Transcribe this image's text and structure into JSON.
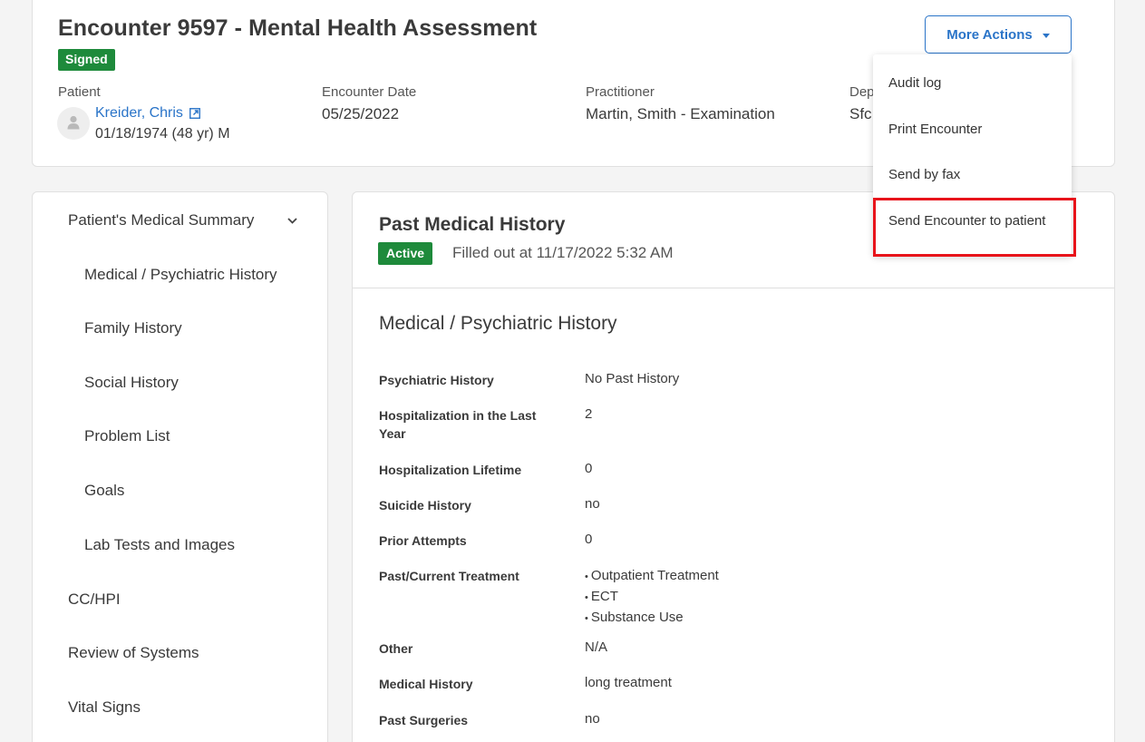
{
  "encounter": {
    "title": "Encounter 9597 - Mental Health Assessment",
    "status": "Signed",
    "patient_label": "Patient",
    "patient_name": "Kreider, Chris",
    "patient_dob": "01/18/1974 (48 yr) M",
    "date_label": "Encounter Date",
    "date_value": "05/25/2022",
    "practitioner_label": "Practitioner",
    "practitioner_value": "Martin, Smith - Examination",
    "department_label": "Dep",
    "department_value": "Sfc"
  },
  "more_actions": {
    "label": "More Actions",
    "items": [
      "Audit log",
      "Print Encounter",
      "Send by fax",
      "Send Encounter to patient"
    ]
  },
  "sidebar": {
    "items": [
      {
        "label": "Patient's Medical Summary",
        "level": "top",
        "expanded": true
      },
      {
        "label": "Medical / Psychiatric History",
        "level": "sub"
      },
      {
        "label": "Family History",
        "level": "sub"
      },
      {
        "label": "Social History",
        "level": "sub"
      },
      {
        "label": "Problem List",
        "level": "sub"
      },
      {
        "label": "Goals",
        "level": "sub"
      },
      {
        "label": "Lab Tests and Images",
        "level": "sub"
      },
      {
        "label": "CC/HPI",
        "level": "top"
      },
      {
        "label": "Review of Systems",
        "level": "top"
      },
      {
        "label": "Vital Signs",
        "level": "top"
      }
    ]
  },
  "main": {
    "title": "Past Medical History",
    "status": "Active",
    "filled_out": "Filled out at 11/17/2022 5:32 AM",
    "section_title": "Medical / Psychiatric History",
    "rows": [
      {
        "label": "Psychiatric History",
        "value": "No Past History"
      },
      {
        "label": "Hospitalization in the Last Year",
        "value": "2"
      },
      {
        "label": "Hospitalization Lifetime",
        "value": "0"
      },
      {
        "label": "Suicide History",
        "value": "no"
      },
      {
        "label": "Prior Attempts",
        "value": "0"
      },
      {
        "label": "Past/Current Treatment",
        "values": [
          "Outpatient Treatment",
          "ECT",
          "Substance Use"
        ]
      },
      {
        "label": "Other",
        "value": "N/A"
      },
      {
        "label": "Medical History",
        "value": "long treatment"
      },
      {
        "label": "Past Surgeries",
        "value": "no"
      }
    ]
  },
  "colors": {
    "link": "#2a74c8",
    "success": "#1e8a3b",
    "highlight": "#e8141b"
  }
}
